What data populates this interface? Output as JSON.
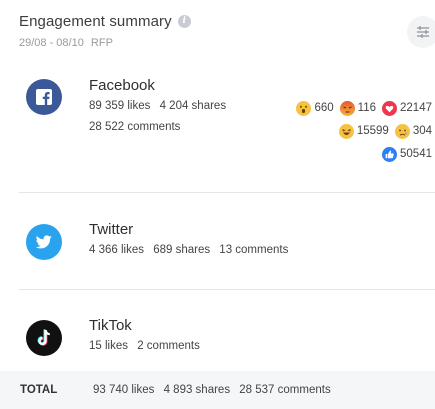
{
  "header": {
    "title": "Engagement summary",
    "date_range": "29/08 - 08/10",
    "account": "RFP"
  },
  "platforms": {
    "facebook": {
      "name": "Facebook",
      "likes": "89 359 likes",
      "shares": "4 204 shares",
      "comments": "28 522 comments",
      "reactions": {
        "wow": "660",
        "angry": "116",
        "love": "22147",
        "haha": "15599",
        "sad": "304",
        "like": "50541"
      },
      "color": "#3b5998"
    },
    "twitter": {
      "name": "Twitter",
      "likes": "4 366 likes",
      "shares": "689 shares",
      "comments": "13 comments",
      "color": "#2aa3ef"
    },
    "tiktok": {
      "name": "TikTok",
      "likes": "15 likes",
      "comments": "2 comments",
      "color": "#111111"
    }
  },
  "total": {
    "label": "TOTAL",
    "likes": "93 740 likes",
    "shares": "4 893 shares",
    "comments": "28 537 comments"
  },
  "icons": {
    "info": "info-icon",
    "settings": "sliders-icon"
  }
}
